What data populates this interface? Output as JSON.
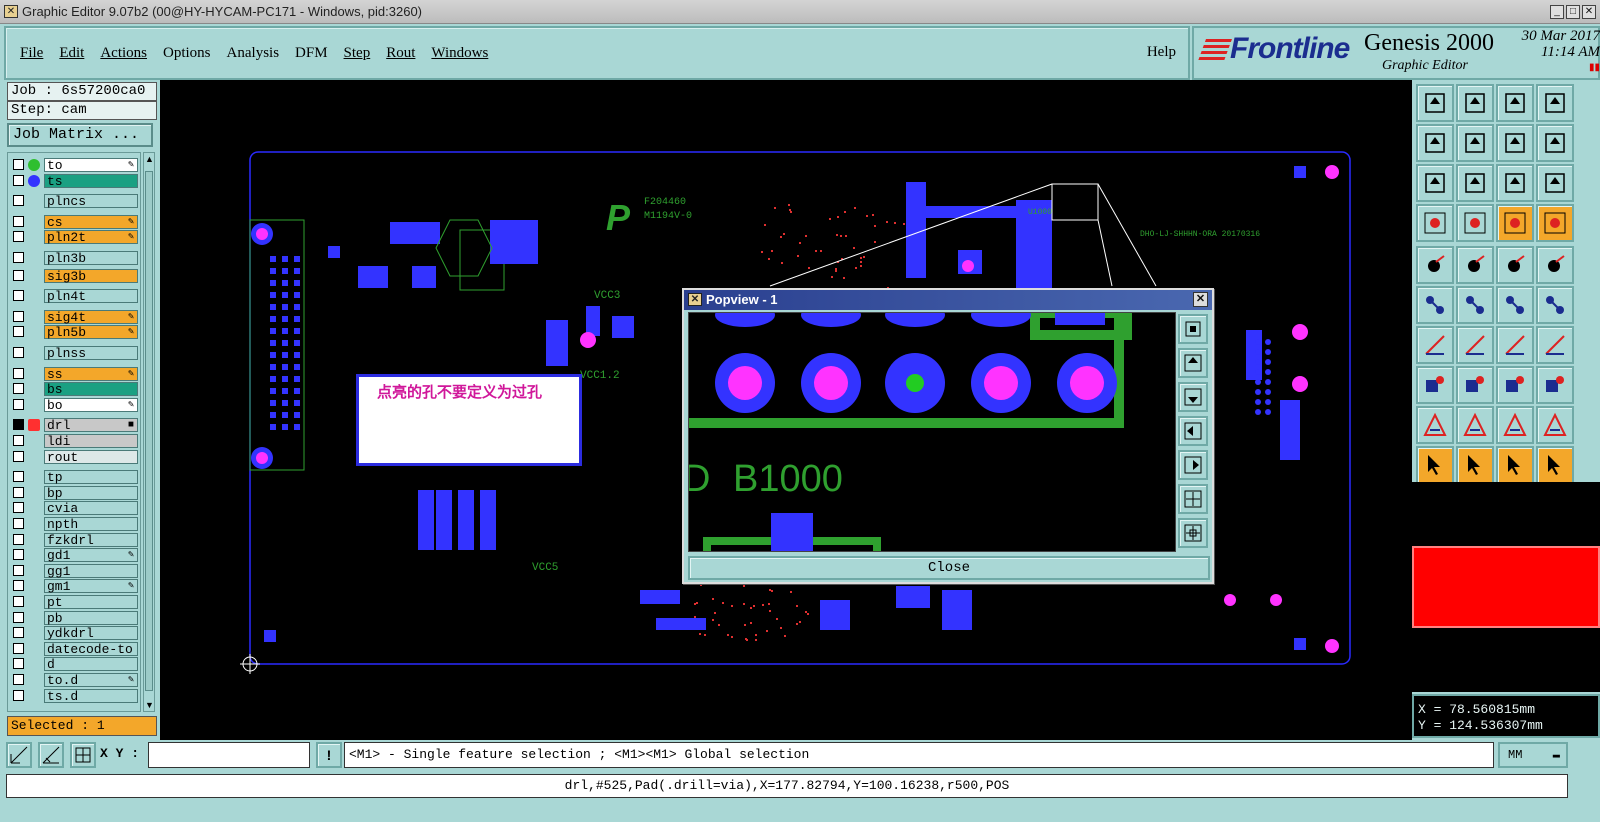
{
  "window": {
    "title": "Graphic Editor 9.07b2 (00@HY-HYCAM-PC171 - Windows, pid:3260)"
  },
  "menu": {
    "items": [
      "File",
      "Edit",
      "Actions",
      "Options",
      "Analysis",
      "DFM",
      "Step",
      "Rout",
      "Windows"
    ],
    "help": "Help"
  },
  "brand": {
    "logo": "Frontline",
    "product": "Genesis 2000",
    "subtitle": "Graphic Editor",
    "date": "30 Mar 2017",
    "time": "11:14 AM"
  },
  "job": {
    "job": "Job : 6s57200ca0",
    "step": "Step: cam",
    "matrix_button": "Job Matrix ..."
  },
  "layers": [
    {
      "name": "to",
      "color": "#ffffff",
      "dot": "#2fbf2f",
      "flag": "✎"
    },
    {
      "name": "ts",
      "color": "#1aa082",
      "dot": "#3333ff",
      "flag": ""
    },
    {
      "name": "plncs",
      "color": "#a9d7d5",
      "flag": ""
    },
    {
      "name": "cs",
      "color": "#f3a72a",
      "flag": "✎"
    },
    {
      "name": "pln2t",
      "color": "#f3a72a",
      "flag": "✎"
    },
    {
      "name": "pln3b",
      "color": "#a9d7d5",
      "flag": ""
    },
    {
      "name": "sig3b",
      "color": "#f3a72a",
      "flag": ""
    },
    {
      "name": "pln4t",
      "color": "#a9d7d5",
      "flag": ""
    },
    {
      "name": "sig4t",
      "color": "#f3a72a",
      "flag": "✎"
    },
    {
      "name": "pln5b",
      "color": "#f3a72a",
      "flag": "✎"
    },
    {
      "name": "plnss",
      "color": "#a9d7d5",
      "flag": ""
    },
    {
      "name": "ss",
      "color": "#f3a72a",
      "flag": "✎"
    },
    {
      "name": "bs",
      "color": "#1aa082",
      "flag": ""
    },
    {
      "name": "bo",
      "color": "#ffffff",
      "flag": "✎"
    },
    {
      "name": "drl",
      "color": "#c8c8c8",
      "flag": "■"
    },
    {
      "name": "ldi",
      "color": "#c8c8c8",
      "flag": ""
    },
    {
      "name": "rout",
      "color": "#dde8e8",
      "flag": ""
    },
    {
      "name": "tp",
      "color": "#a9d7d5",
      "flag": ""
    },
    {
      "name": "bp",
      "color": "#a9d7d5",
      "flag": ""
    },
    {
      "name": "cvia",
      "color": "#a9d7d5",
      "flag": ""
    },
    {
      "name": "npth",
      "color": "#a9d7d5",
      "flag": ""
    },
    {
      "name": "fzkdrl",
      "color": "#a9d7d5",
      "flag": ""
    },
    {
      "name": "gd1",
      "color": "#a9d7d5",
      "flag": "✎"
    },
    {
      "name": "gg1",
      "color": "#a9d7d5",
      "flag": ""
    },
    {
      "name": "gm1",
      "color": "#a9d7d5",
      "flag": "✎"
    },
    {
      "name": "pt",
      "color": "#a9d7d5",
      "flag": ""
    },
    {
      "name": "pb",
      "color": "#a9d7d5",
      "flag": ""
    },
    {
      "name": "ydkdrl",
      "color": "#a9d7d5",
      "flag": ""
    },
    {
      "name": "datecode-to",
      "color": "#a9d7d5",
      "flag": ""
    },
    {
      "name": "d",
      "color": "#a9d7d5",
      "flag": ""
    },
    {
      "name": "to.d",
      "color": "#a9d7d5",
      "flag": "✎"
    },
    {
      "name": "ts.d",
      "color": "#a9d7d5",
      "flag": ""
    }
  ],
  "selected": "Selected : 1",
  "canvas": {
    "annotation": "点亮的孔不要定义为过孔",
    "labels": [
      "F204460",
      "M1194V-0",
      "VCC3",
      "VCC1.2",
      "VCC5",
      "DHO-LJ-SHHHN-ORA 20170316",
      "U1000",
      "B1000"
    ]
  },
  "popview": {
    "title": "Popview - 1",
    "label": "B1000",
    "close": "Close"
  },
  "coords": {
    "x": "X = 78.560815mm",
    "y": "Y = 124.536307mm"
  },
  "bottom": {
    "xy_label": "X Y :",
    "xy_value": "",
    "help": "<M1> - Single feature selection ; <M1><M1> Global selection",
    "unit": "MM",
    "status": "drl,#525,Pad(.drill=via),X=177.82794,Y=100.16238,r500,POS"
  },
  "colors": {
    "board_outline": "#2a2aff",
    "trace": "#2fa02f",
    "pad": "#3333ff",
    "hole": "#ff33ff",
    "accent": "#f3a72a"
  }
}
